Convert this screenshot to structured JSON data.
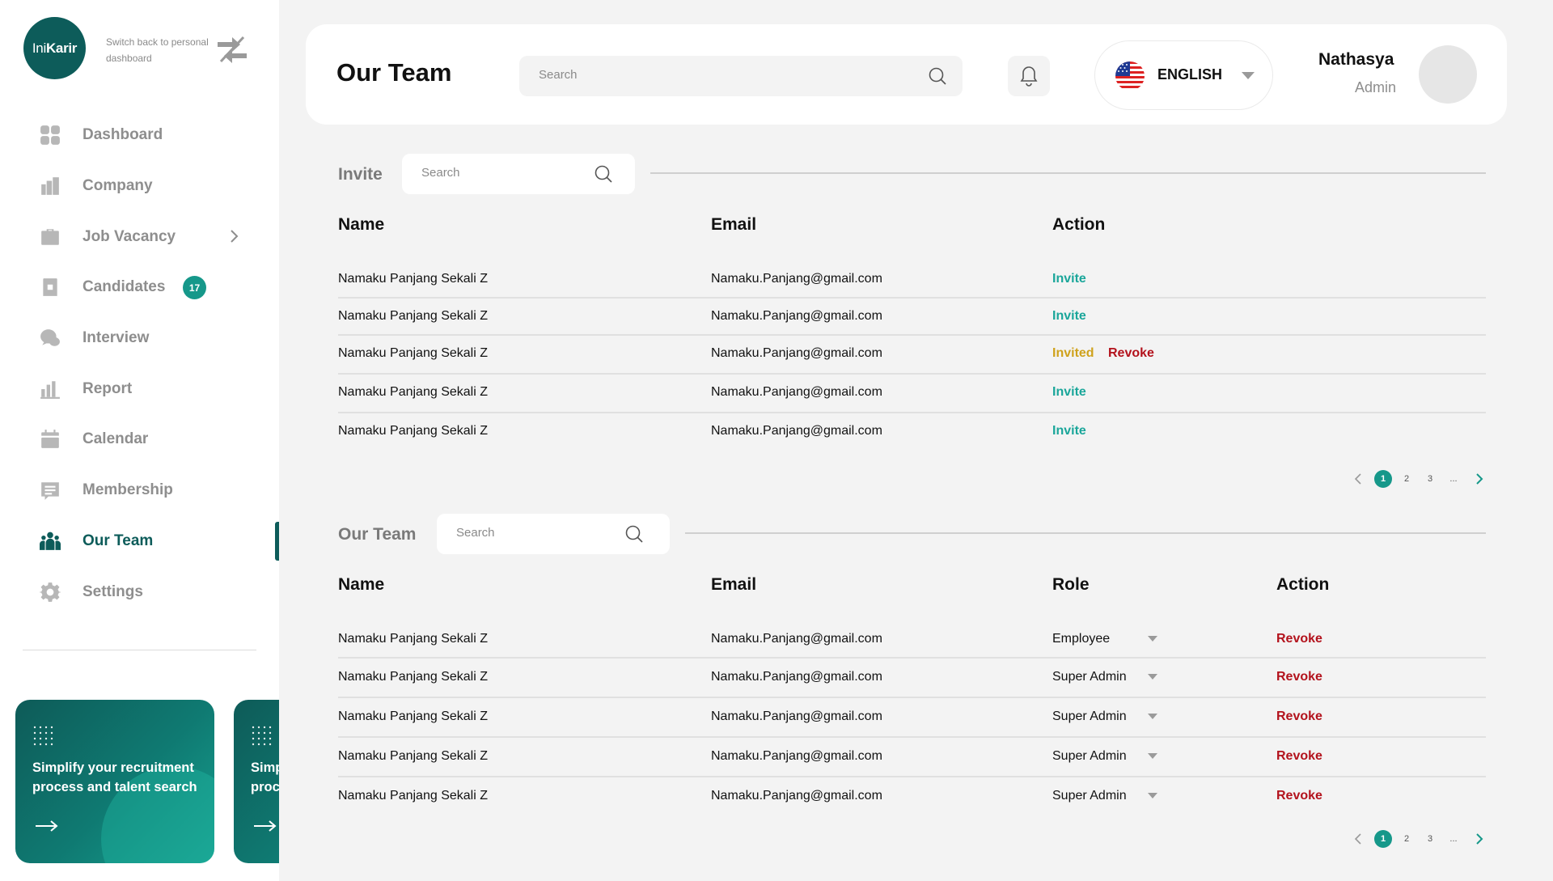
{
  "brand": {
    "logo_light": "Ini",
    "logo_bold": "Karir",
    "switch_text": "Switch back to personal dashboard"
  },
  "nav": {
    "items": [
      {
        "label": "Dashboard",
        "icon": "dashboard-icon"
      },
      {
        "label": "Company",
        "icon": "company-icon"
      },
      {
        "label": "Job Vacancy",
        "icon": "briefcase-icon"
      },
      {
        "label": "Candidates",
        "icon": "candidates-icon",
        "badge": "17"
      },
      {
        "label": "Interview",
        "icon": "chat-icon"
      },
      {
        "label": "Report",
        "icon": "report-icon"
      },
      {
        "label": "Calendar",
        "icon": "calendar-icon"
      },
      {
        "label": "Membership",
        "icon": "membership-icon"
      },
      {
        "label": "Our Team",
        "icon": "team-icon",
        "active": true
      },
      {
        "label": "Settings",
        "icon": "gear-icon"
      }
    ]
  },
  "promo": {
    "text": "Simplify your recruitment process and talent search"
  },
  "header": {
    "title": "Our Team",
    "search_placeholder": "Search",
    "language": "ENGLISH",
    "user_name": "Nathasya",
    "user_role": "Admin"
  },
  "invite": {
    "title": "Invite",
    "search_placeholder": "Search",
    "columns": {
      "name": "Name",
      "email": "Email",
      "action": "Action"
    },
    "rows": [
      {
        "name": "Namaku Panjang Sekali Z",
        "email": "Namaku.Panjang@gmail.com",
        "status": "Invite"
      },
      {
        "name": "Namaku Panjang Sekali Z",
        "email": "Namaku.Panjang@gmail.com",
        "status": "Invite"
      },
      {
        "name": "Namaku Panjang Sekali Z",
        "email": "Namaku.Panjang@gmail.com",
        "status": "Invited",
        "revoke": "Revoke"
      },
      {
        "name": "Namaku Panjang Sekali Z",
        "email": "Namaku.Panjang@gmail.com",
        "status": "Invite"
      },
      {
        "name": "Namaku Panjang Sekali Z",
        "email": "Namaku.Panjang@gmail.com",
        "status": "Invite"
      }
    ],
    "pagination": {
      "pages": [
        "1",
        "2",
        "3",
        "..."
      ],
      "current": "1"
    }
  },
  "team": {
    "title": "Our Team",
    "search_placeholder": "Search",
    "columns": {
      "name": "Name",
      "email": "Email",
      "role": "Role",
      "action": "Action"
    },
    "rows": [
      {
        "name": "Namaku Panjang Sekali Z",
        "email": "Namaku.Panjang@gmail.com",
        "role": "Employee",
        "action": "Revoke"
      },
      {
        "name": "Namaku Panjang Sekali Z",
        "email": "Namaku.Panjang@gmail.com",
        "role": "Super Admin",
        "action": "Revoke"
      },
      {
        "name": "Namaku Panjang Sekali Z",
        "email": "Namaku.Panjang@gmail.com",
        "role": "Super Admin",
        "action": "Revoke"
      },
      {
        "name": "Namaku Panjang Sekali Z",
        "email": "Namaku.Panjang@gmail.com",
        "role": "Super Admin",
        "action": "Revoke"
      },
      {
        "name": "Namaku Panjang Sekali Z",
        "email": "Namaku.Panjang@gmail.com",
        "role": "Super Admin",
        "action": "Revoke"
      }
    ],
    "pagination": {
      "pages": [
        "1",
        "2",
        "3",
        "..."
      ],
      "current": "1"
    }
  },
  "colors": {
    "brand": "#0d5c5a",
    "accent": "#16988a",
    "invite": "#1aa69a",
    "invited": "#cfa21c",
    "revoke": "#b3121c"
  }
}
